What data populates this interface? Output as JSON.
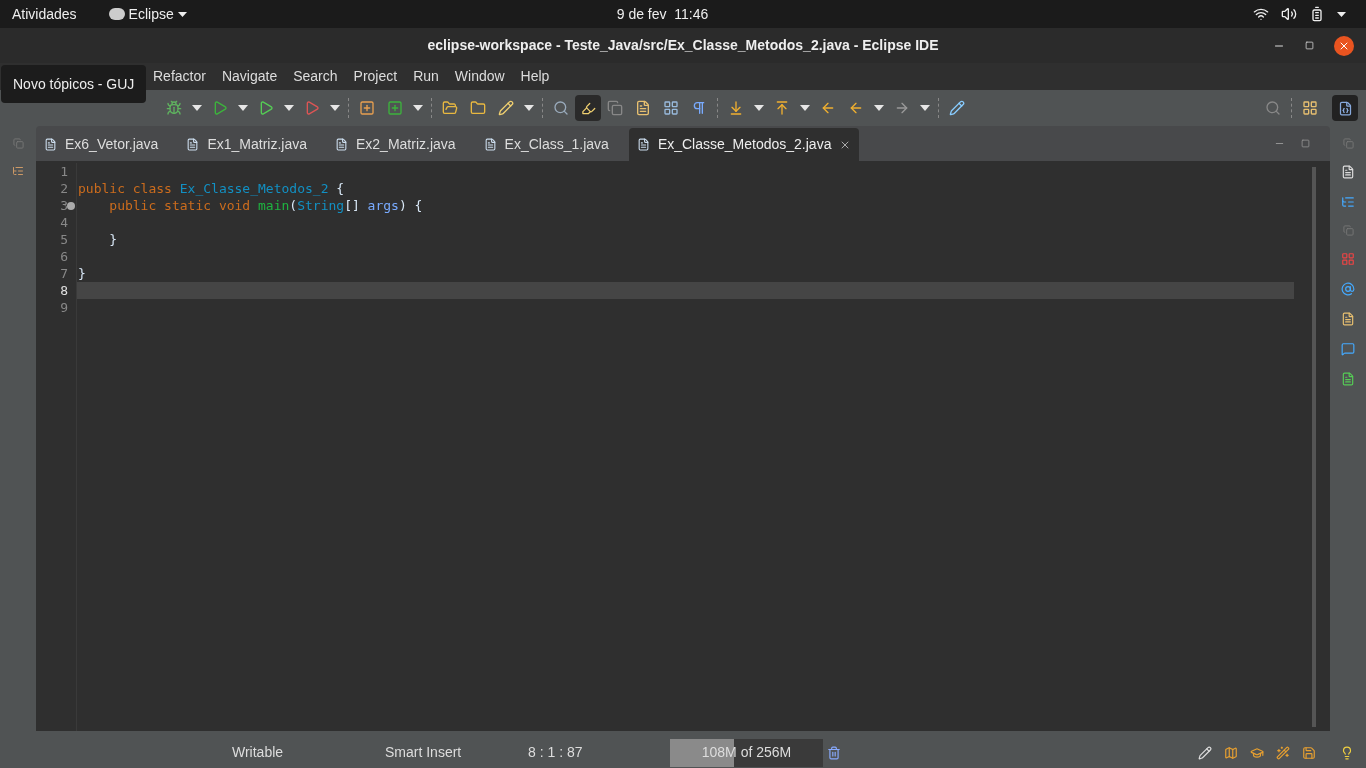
{
  "top_bar": {
    "activities": "Atividades",
    "app_menu": "Eclipse",
    "clock": "9 de fev  11:46"
  },
  "window": {
    "title": "eclipse-workspace - Teste_Java/src/Ex_Classe_Metodos_2.java - Eclipse IDE"
  },
  "menu": [
    "Refactor",
    "Navigate",
    "Search",
    "Project",
    "Run",
    "Window",
    "Help"
  ],
  "tooltip": "Novo tópicos - GUJ",
  "tabs": [
    {
      "label": "Ex6_Vetor.java",
      "selected": false
    },
    {
      "label": "Ex1_Matriz.java",
      "selected": false
    },
    {
      "label": "Ex2_Matriz.java",
      "selected": false
    },
    {
      "label": "Ex_Class_1.java",
      "selected": false
    },
    {
      "label": "Ex_Classe_Metodos_2.java",
      "selected": true
    }
  ],
  "editor": {
    "lines": [
      {
        "number": "1",
        "current": false,
        "fold": false
      },
      {
        "number": "2",
        "current": false,
        "fold": false,
        "tokens": [
          {
            "kind": "keyword",
            "text": "public class "
          },
          {
            "kind": "type",
            "text": "Ex_Classe_Metodos_2"
          },
          {
            "kind": "plain",
            "text": " {"
          }
        ]
      },
      {
        "number": "3",
        "current": false,
        "fold": true,
        "tokens": [
          {
            "kind": "keyword",
            "text": "    public static void "
          },
          {
            "kind": "method",
            "text": "main"
          },
          {
            "kind": "plain",
            "text": "("
          },
          {
            "kind": "type",
            "text": "String"
          },
          {
            "kind": "plain",
            "text": "[] "
          },
          {
            "kind": "param",
            "text": "args"
          },
          {
            "kind": "plain",
            "text": ") {"
          }
        ]
      },
      {
        "number": "4",
        "current": false,
        "fold": false
      },
      {
        "number": "5",
        "current": false,
        "fold": false,
        "tokens": [
          {
            "kind": "plain",
            "text": "    }"
          }
        ]
      },
      {
        "number": "6",
        "current": false,
        "fold": false
      },
      {
        "number": "7",
        "current": false,
        "fold": false,
        "tokens": [
          {
            "kind": "plain",
            "text": "}"
          }
        ]
      },
      {
        "number": "8",
        "current": true,
        "fold": false
      },
      {
        "number": "9",
        "current": false,
        "fold": false
      }
    ]
  },
  "status_bar": {
    "mode": "Writable",
    "insert": "Smart Insert",
    "position": "8 : 1 : 87",
    "memory": {
      "used": "108M",
      "total": " of 256M",
      "level": 0.42
    }
  }
}
